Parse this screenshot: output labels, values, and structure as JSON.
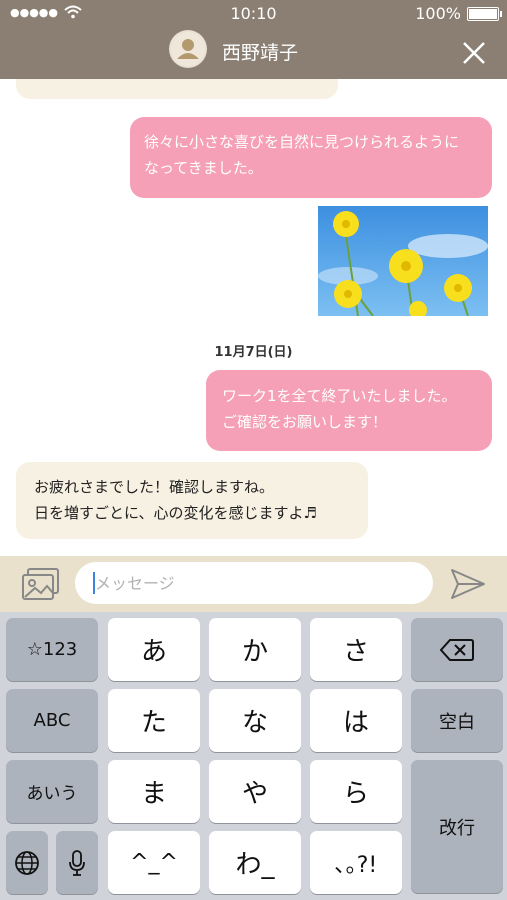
{
  "status": {
    "time": "10:10",
    "battery": "100%"
  },
  "header": {
    "contact_name": "西野靖子"
  },
  "messages": {
    "m1": "徐々に小さな喜びを自然に見つけられるように",
    "m1b": "なってきました。",
    "date": "11月7日(日)",
    "m2": "ワーク1を全て終了いたしました。",
    "m2b": "ご確認をお願いします！",
    "m3": "お疲れさまでした！確認しますね。",
    "m3b": "日を増すごとに、心の変化を感じますよ♬"
  },
  "input": {
    "placeholder": "メッセージ"
  },
  "keyboard": {
    "k_num": "☆123",
    "k_a": "あ",
    "k_ka": "か",
    "k_sa": "さ",
    "k_abc": "ABC",
    "k_ta": "た",
    "k_na": "な",
    "k_ha": "は",
    "k_space": "空白",
    "k_aiu": "あいう",
    "k_ma": "ま",
    "k_ya": "や",
    "k_ra": "ら",
    "k_enter": "改行",
    "k_emo": "^_^",
    "k_wa": "わ_",
    "k_punct": "､｡?!"
  },
  "colors": {
    "header": "#8a7f72",
    "incoming_bubble": "#f6f1e2",
    "outgoing_bubble": "#f5a0b6",
    "input_bar": "#e9e1cc",
    "keyboard": "#d0d3d9"
  },
  "icons": {
    "wifi": "wifi-icon",
    "close": "close-icon",
    "gallery": "gallery-icon",
    "send": "send-icon",
    "backspace": "backspace-icon",
    "globe": "globe-icon",
    "mic": "microphone-icon"
  }
}
